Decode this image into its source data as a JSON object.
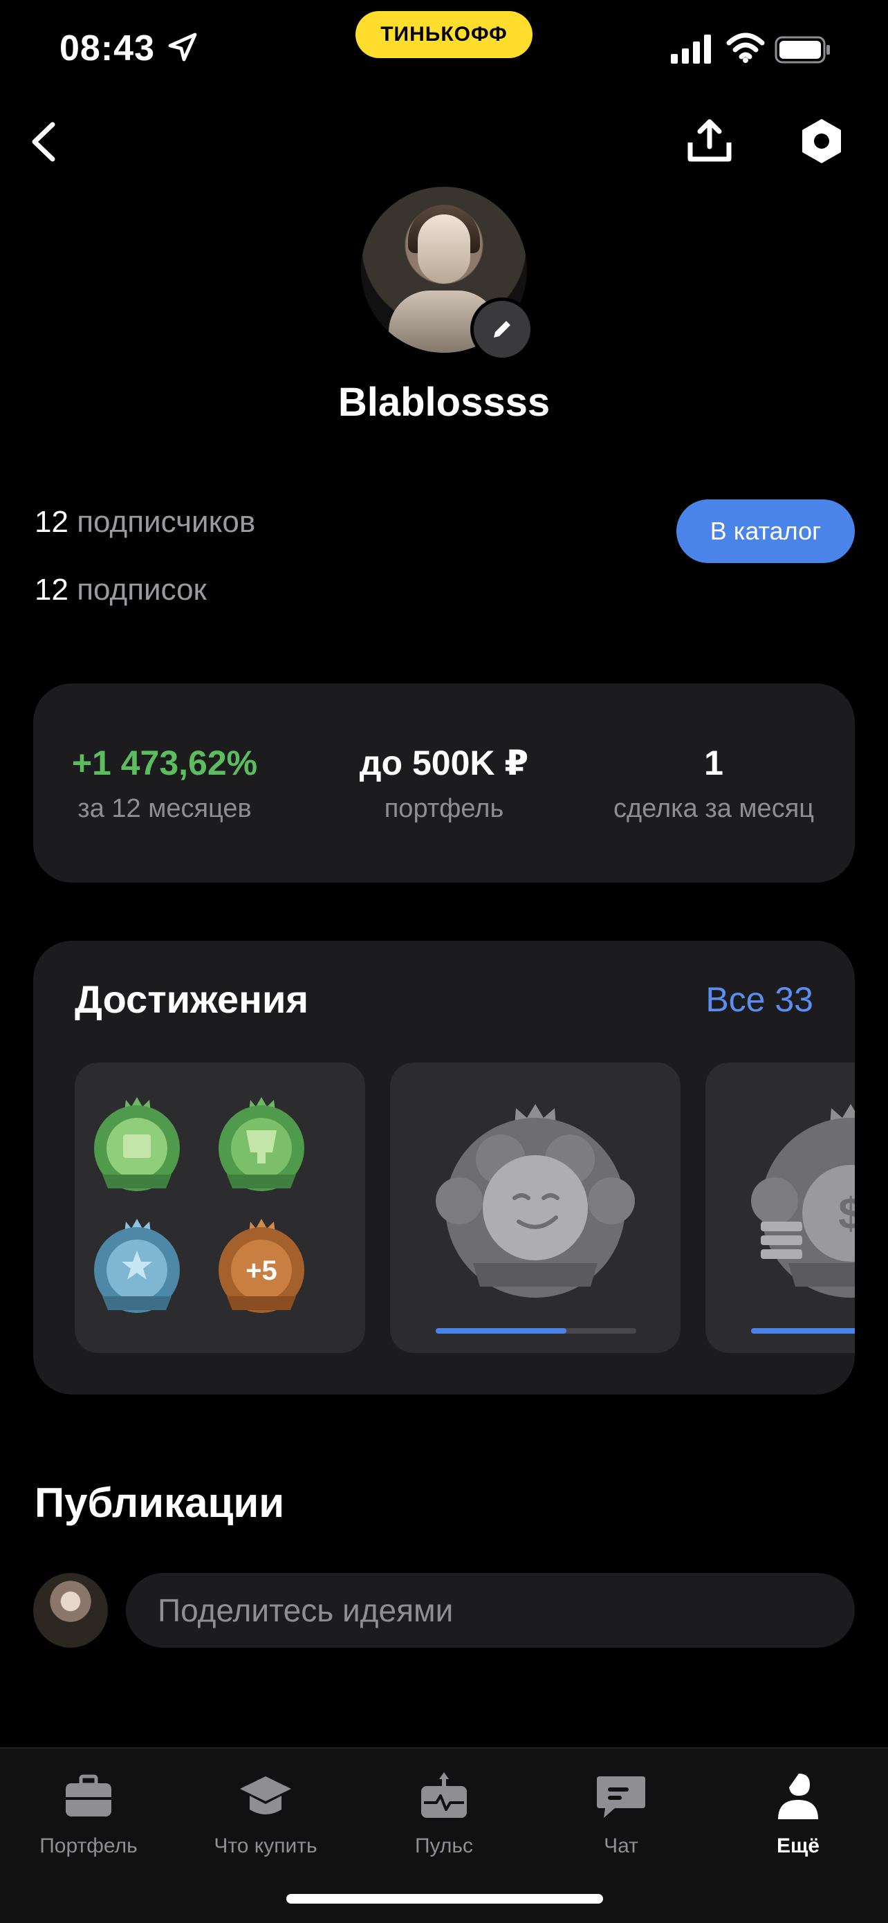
{
  "status_bar": {
    "time": "08:43",
    "brand": "ТИНЬКОФФ"
  },
  "profile": {
    "name": "Blablossss",
    "followers_count": "12",
    "followers_label": "подписчиков",
    "following_count": "12",
    "following_label": "подписок",
    "catalog_button": "В каталог"
  },
  "metrics": [
    {
      "value": "+1 473,62%",
      "label": "за 12 месяцев",
      "color": "#5bbd5e"
    },
    {
      "value": "до 500K ₽",
      "label": "портфель",
      "color": "#ffffff"
    },
    {
      "value": "1",
      "label": "сделка за месяц",
      "color": "#ffffff"
    }
  ],
  "achievements": {
    "title": "Достижения",
    "all_link": "Все 33",
    "more_badge": "+5",
    "tiles": [
      {
        "kind": "group",
        "badges": [
          "green-money-badge",
          "green-trophy-badge",
          "blue-stars-badge",
          "bronze-plus-badge"
        ]
      },
      {
        "kind": "single",
        "badge": "silver-smile-badge",
        "progress": 0.65
      },
      {
        "kind": "single",
        "badge": "silver-money-bag-badge",
        "progress": 0.6
      }
    ]
  },
  "publications": {
    "title": "Публикации",
    "input_placeholder": "Поделитесь идеями"
  },
  "tabbar": {
    "items": [
      {
        "label": "Портфель",
        "icon": "briefcase-icon",
        "active": false
      },
      {
        "label": "Что купить",
        "icon": "graduation-cap-icon",
        "active": false
      },
      {
        "label": "Пульс",
        "icon": "pulse-icon",
        "active": false
      },
      {
        "label": "Чат",
        "icon": "chat-icon",
        "active": false
      },
      {
        "label": "Ещё",
        "icon": "more-person-icon",
        "active": true
      }
    ]
  },
  "colors": {
    "accent": "#4b84e8",
    "positive": "#5bbd5e",
    "card": "#1c1c1e",
    "brand": "#ffdd2d"
  }
}
